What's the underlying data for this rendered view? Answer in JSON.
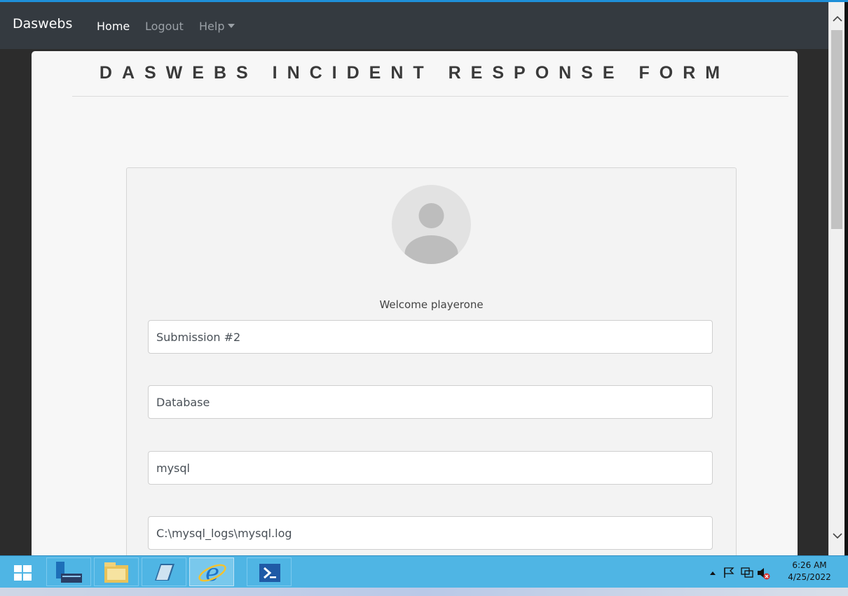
{
  "navbar": {
    "brand": "Daswebs",
    "links": [
      {
        "label": "Home",
        "active": true
      },
      {
        "label": "Logout",
        "active": false
      },
      {
        "label": "Help",
        "active": false
      }
    ]
  },
  "form": {
    "title": "DASWEBS INCIDENT RESPONSE FORM",
    "welcome": "Welcome playerone",
    "fields": [
      {
        "value": "Submission #2"
      },
      {
        "value": "Database"
      },
      {
        "value": "mysql"
      },
      {
        "value": "C:\\mysql_logs\\mysql.log"
      }
    ]
  },
  "taskbar": {
    "apps": [
      "start-icon",
      "server-manager-icon",
      "file-explorer-icon",
      "notepad-icon",
      "internet-explorer-icon",
      "powershell-icon"
    ],
    "clock": {
      "time": "6:26 AM",
      "date": "4/25/2022"
    }
  },
  "colors": {
    "navbar": "#343a40",
    "taskbar": "#4fb5e4",
    "card": "#f3f3f3"
  }
}
